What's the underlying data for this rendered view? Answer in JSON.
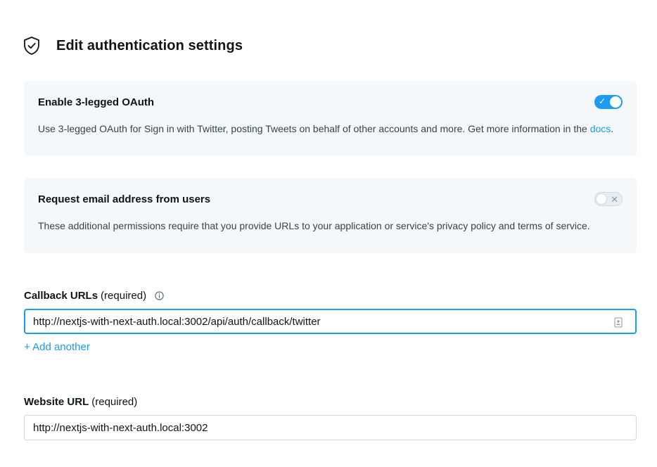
{
  "header": {
    "title": "Edit authentication settings",
    "icon": "shield-check-icon"
  },
  "oauth": {
    "title": "Enable 3-legged OAuth",
    "description": "Use 3-legged OAuth for Sign in with Twitter, posting Tweets on behalf of other accounts and more. Get more information in the ",
    "link_text": "docs",
    "trailing": ".",
    "enabled": true,
    "toggle_mark": "✓"
  },
  "email": {
    "title": "Request email address from users",
    "description": "These additional permissions require that you provide URLs to your application or service's privacy policy and terms of service.",
    "enabled": false,
    "toggle_mark": "✕"
  },
  "callback": {
    "label": "Callback URLs",
    "required": "(required)",
    "value": "http://nextjs-with-next-auth.local:3002/api/auth/callback/twitter",
    "add_another": "+ Add another"
  },
  "website": {
    "label": "Website URL",
    "required": "(required)",
    "value": "http://nextjs-with-next-auth.local:3002"
  },
  "colors": {
    "accent": "#1d9bf0",
    "card_bg": "#f5f8fa",
    "text": "#0f1419"
  }
}
